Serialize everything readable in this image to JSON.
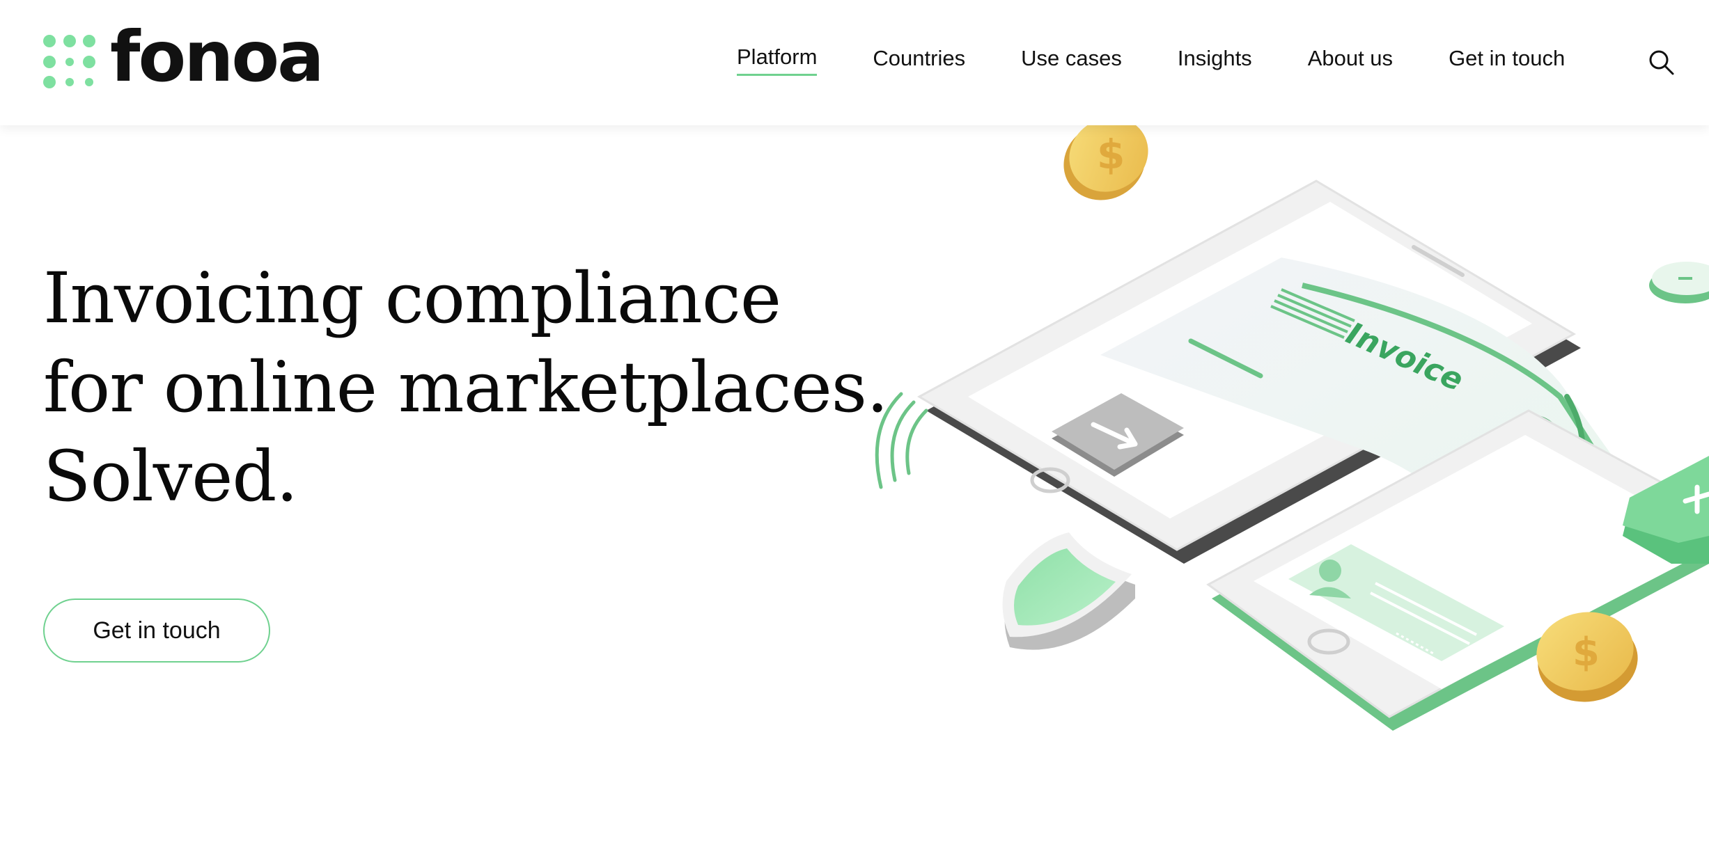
{
  "brand": {
    "name": "fonoa",
    "accent_color": "#6fd18f",
    "dot_color": "#7ee0a0"
  },
  "nav": {
    "items": [
      {
        "label": "Platform",
        "active": true
      },
      {
        "label": "Countries",
        "active": false
      },
      {
        "label": "Use cases",
        "active": false
      },
      {
        "label": "Insights",
        "active": false
      },
      {
        "label": "About us",
        "active": false
      },
      {
        "label": "Get in touch",
        "active": false
      }
    ],
    "search_icon": "search-icon"
  },
  "hero": {
    "title_lines": [
      "Invoicing compliance",
      "for online marketplaces.",
      "Solved."
    ],
    "cta_label": "Get in touch"
  },
  "illustration": {
    "invoice_label": "Invoice",
    "coin_symbol": "$"
  }
}
